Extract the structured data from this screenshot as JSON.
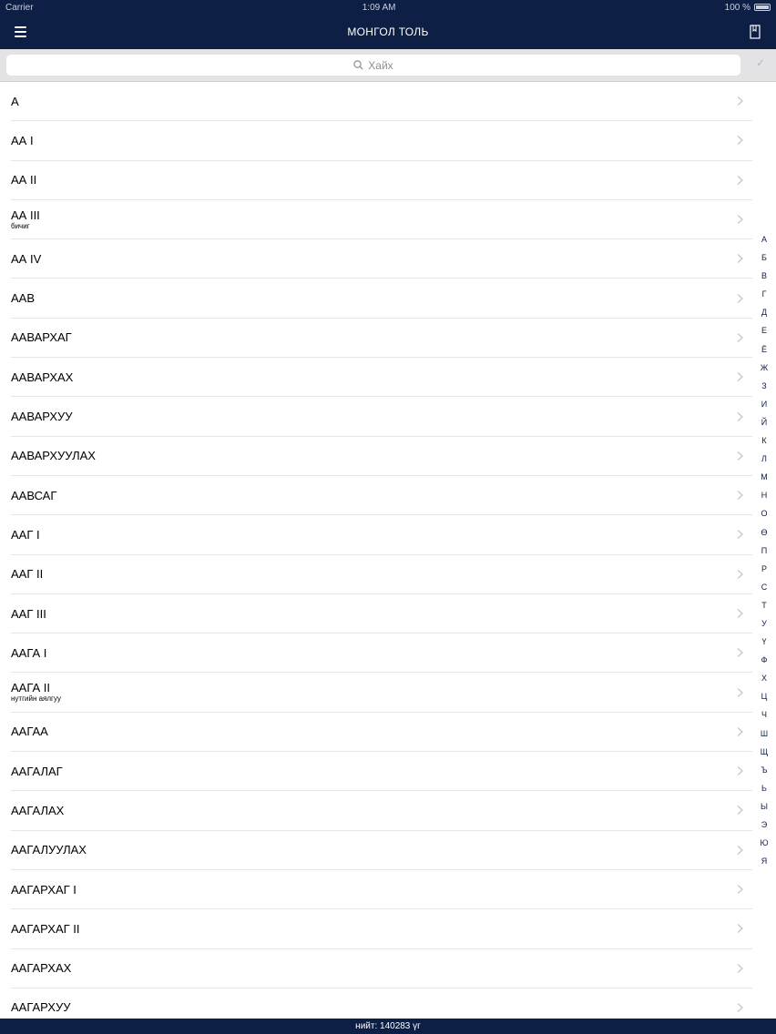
{
  "status_bar": {
    "carrier": "Carrier",
    "time": "1:09 AM",
    "battery": "100 %"
  },
  "nav": {
    "title": "МОНГОЛ ТОЛЬ"
  },
  "search": {
    "placeholder": "Хайх"
  },
  "words": [
    {
      "title": "А",
      "sub": ""
    },
    {
      "title": "АА I",
      "sub": ""
    },
    {
      "title": "АА II",
      "sub": ""
    },
    {
      "title": "АА III",
      "sub": "бичиг"
    },
    {
      "title": "АА IV",
      "sub": ""
    },
    {
      "title": "ААВ",
      "sub": ""
    },
    {
      "title": "ААВАРХАГ",
      "sub": ""
    },
    {
      "title": "ААВАРХАХ",
      "sub": ""
    },
    {
      "title": "ААВАРХУУ",
      "sub": ""
    },
    {
      "title": "ААВАРХУУЛАХ",
      "sub": ""
    },
    {
      "title": "ААВСАГ",
      "sub": ""
    },
    {
      "title": "ААГ I",
      "sub": ""
    },
    {
      "title": "ААГ II",
      "sub": ""
    },
    {
      "title": "ААГ III",
      "sub": ""
    },
    {
      "title": "ААГА I",
      "sub": ""
    },
    {
      "title": "ААГА II",
      "sub": "нутгийн аялгуу"
    },
    {
      "title": "ААГАА",
      "sub": ""
    },
    {
      "title": "ААГАЛАГ",
      "sub": ""
    },
    {
      "title": "ААГАЛАХ",
      "sub": ""
    },
    {
      "title": "ААГАЛУУЛАХ",
      "sub": ""
    },
    {
      "title": "ААГАРХАГ I",
      "sub": ""
    },
    {
      "title": "ААГАРХАГ II",
      "sub": ""
    },
    {
      "title": "ААГАРХАХ",
      "sub": ""
    },
    {
      "title": "ААГАРХУУ",
      "sub": ""
    }
  ],
  "alphabet": [
    "А",
    "Б",
    "В",
    "Г",
    "Д",
    "Е",
    "Ё",
    "Ж",
    "З",
    "И",
    "Й",
    "К",
    "Л",
    "М",
    "Н",
    "О",
    "Ө",
    "П",
    "Р",
    "С",
    "Т",
    "У",
    "Ү",
    "Ф",
    "Х",
    "Ц",
    "Ч",
    "Ш",
    "Щ",
    "Ъ",
    "Ь",
    "Ы",
    "Э",
    "Ю",
    "Я"
  ],
  "footer": {
    "text": "нийт: 140283 үг"
  },
  "icons": {
    "menu": "hamburger-menu-icon",
    "bookmark": "bookmark-icon",
    "search": "search-icon",
    "check": "checkmark-icon",
    "chevron": "chevron-right-icon"
  },
  "colors": {
    "nav_bg": "#0e1f45",
    "search_bg": "#e3e3e6",
    "divider": "#e6e6e6",
    "chevron": "#c7c7cc"
  }
}
